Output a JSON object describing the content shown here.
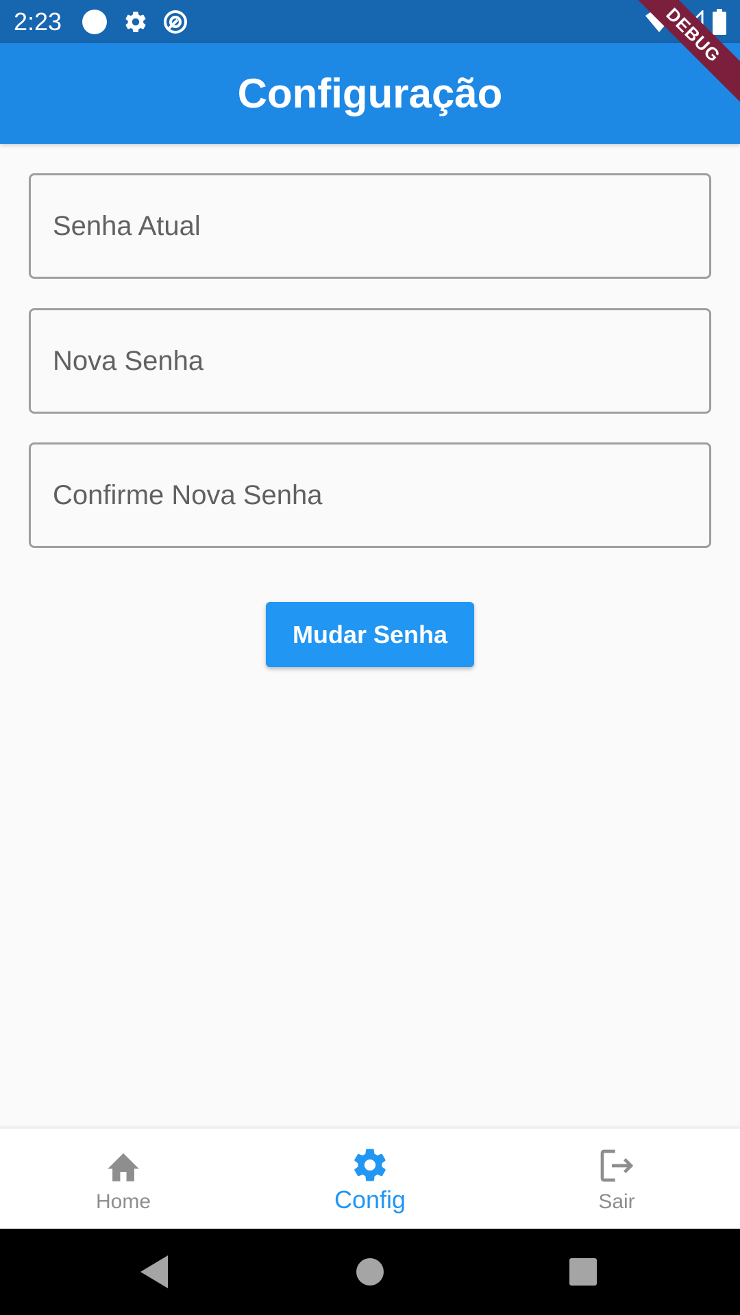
{
  "status_bar": {
    "time": "2:23",
    "icons": [
      "circle-icon",
      "gear-icon",
      "sync-icon",
      "wifi-icon",
      "signal-icon",
      "battery-icon"
    ]
  },
  "debug_banner": {
    "label": "DEBUG"
  },
  "app_bar": {
    "title": "Configuração"
  },
  "form": {
    "current_password": {
      "placeholder": "Senha Atual",
      "value": ""
    },
    "new_password": {
      "placeholder": "Nova Senha",
      "value": ""
    },
    "confirm_password": {
      "placeholder": "Confirme Nova Senha",
      "value": ""
    },
    "submit_label": "Mudar Senha"
  },
  "bottom_nav": {
    "items": [
      {
        "label": "Home",
        "icon": "home-icon",
        "active": false
      },
      {
        "label": "Config",
        "icon": "settings-icon",
        "active": true
      },
      {
        "label": "Sair",
        "icon": "logout-icon",
        "active": false
      }
    ]
  },
  "colors": {
    "status_bar": "#1766b0",
    "app_bar": "#1e88e5",
    "accent": "#2196f3",
    "inactive": "#8e8e8e",
    "debug_banner": "#7b1f3d"
  },
  "system_nav": {
    "buttons": [
      "back-icon",
      "home-circle-icon",
      "recents-icon"
    ]
  }
}
